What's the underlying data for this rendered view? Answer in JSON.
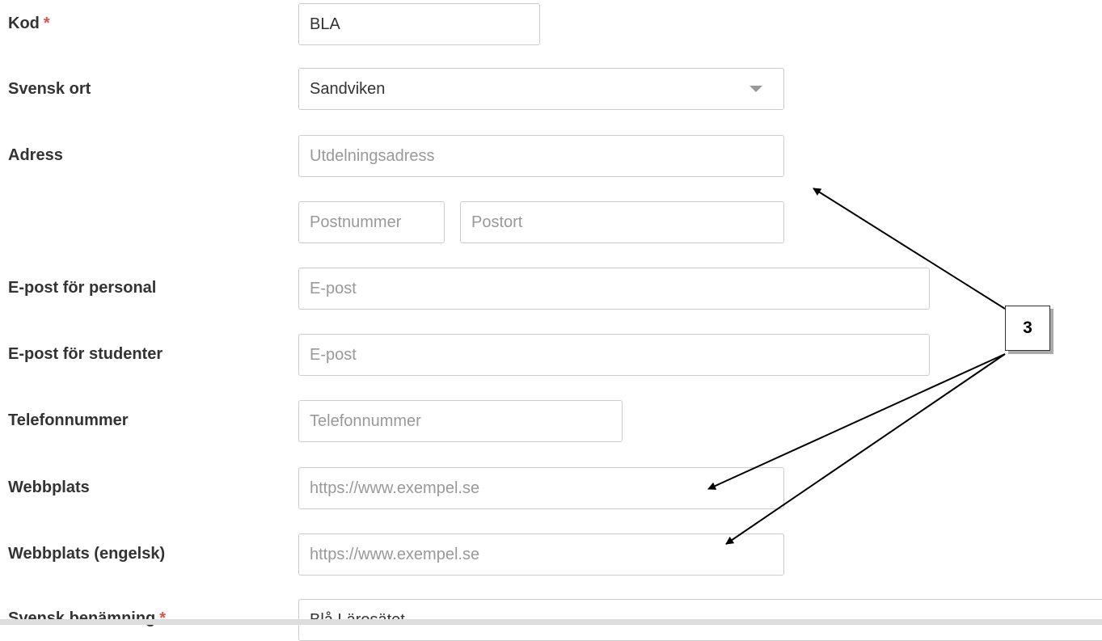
{
  "form": {
    "kod": {
      "label": "Kod",
      "required_mark": "*",
      "value": "BLA"
    },
    "svensk_ort": {
      "label": "Svensk ort",
      "selected": "Sandviken"
    },
    "adress": {
      "label": "Adress",
      "utdelning_placeholder": "Utdelningsadress",
      "postnummer_placeholder": "Postnummer",
      "postort_placeholder": "Postort"
    },
    "epost_personal": {
      "label": "E-post för personal",
      "placeholder": "E-post"
    },
    "epost_studenter": {
      "label": "E-post för studenter",
      "placeholder": "E-post"
    },
    "telefon": {
      "label": "Telefonnummer",
      "placeholder": "Telefonnummer"
    },
    "webbplats": {
      "label": "Webbplats",
      "placeholder": "https://www.exempel.se"
    },
    "webbplats_engelsk": {
      "label": "Webbplats (engelsk)",
      "placeholder": "https://www.exempel.se"
    },
    "svensk_benamning": {
      "label": "Svensk benämning",
      "required_mark": "*",
      "value": "Blå Lärosätet"
    }
  },
  "annotation": {
    "callout_number": "3"
  },
  "colors": {
    "required": "#d9534f",
    "border": "#cccccc",
    "label": "#333333",
    "placeholder": "#999999"
  },
  "icons": {
    "select_caret": "chevron-down-icon"
  }
}
